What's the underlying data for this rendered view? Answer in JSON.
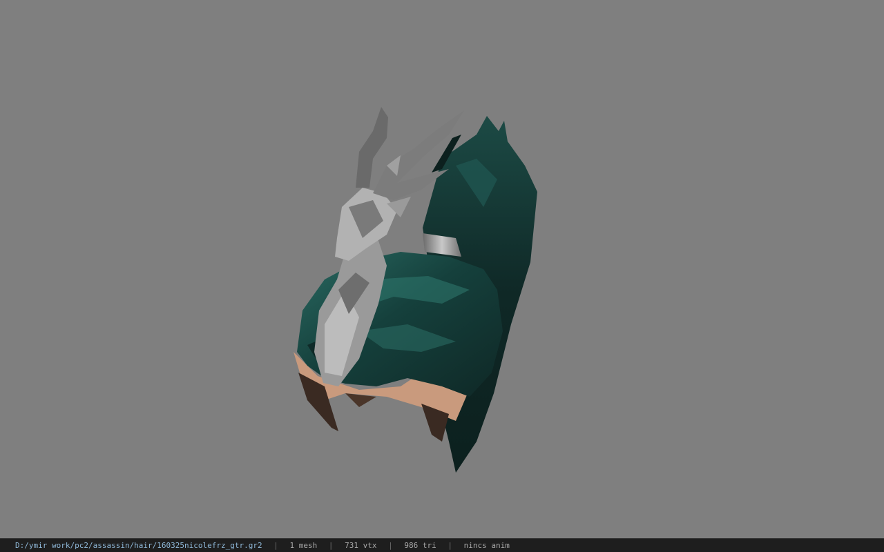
{
  "viewer": {
    "background_color": "#7f7f7f",
    "model_colors": {
      "hair_dark": "#0f2826",
      "hair_mid": "#15403c",
      "hair_highlight": "#2a6a62",
      "ornament": "#a8a8a8",
      "ornament_dark": "#5a5a5a",
      "skin": "#c99a7d",
      "skin_shadow": "#3a2a22"
    }
  },
  "status": {
    "file_path": "D:/ymir work/pc2/assassin/hair/160325nicolefrz_gtr.gr2",
    "separator": "|",
    "mesh_count": "1 mesh",
    "vertex_count": "731 vtx",
    "triangle_count": "986 tri",
    "anim_status": "nincs anim"
  }
}
